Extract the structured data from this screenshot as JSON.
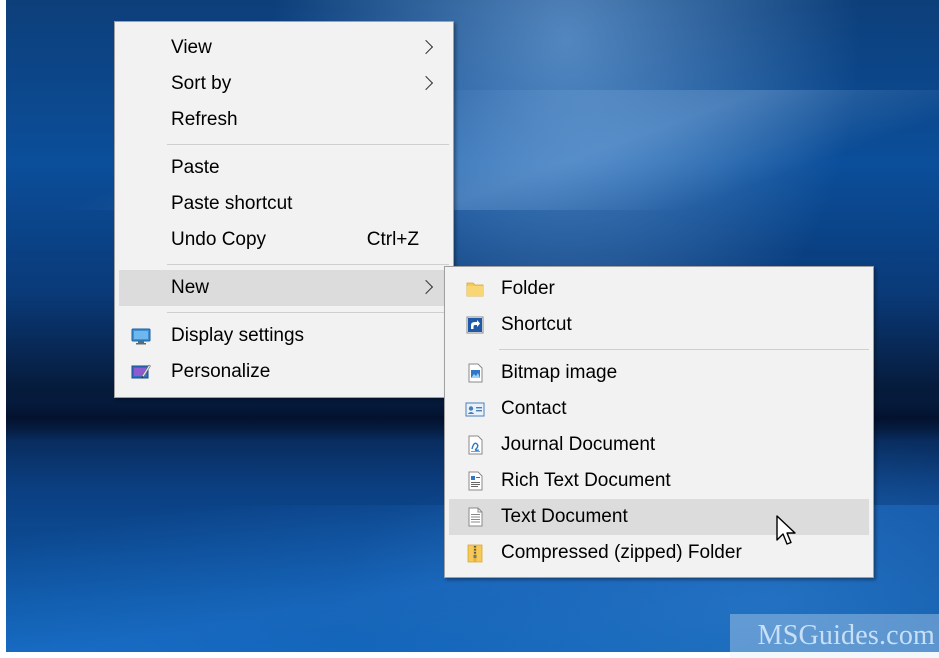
{
  "context_menu": {
    "items": [
      {
        "label": "View",
        "submenu": true
      },
      {
        "label": "Sort by",
        "submenu": true
      },
      {
        "label": "Refresh"
      },
      {
        "label": "Paste"
      },
      {
        "label": "Paste shortcut"
      },
      {
        "label": "Undo Copy",
        "shortcut": "Ctrl+Z"
      },
      {
        "label": "New",
        "submenu": true,
        "highlighted": true
      },
      {
        "label": "Display settings",
        "icon": "display-settings-icon"
      },
      {
        "label": "Personalize",
        "icon": "personalize-icon"
      }
    ]
  },
  "new_submenu": {
    "items": [
      {
        "label": "Folder",
        "icon": "folder-icon"
      },
      {
        "label": "Shortcut",
        "icon": "shortcut-icon"
      },
      {
        "label": "Bitmap image",
        "icon": "bitmap-image-icon"
      },
      {
        "label": "Contact",
        "icon": "contact-icon"
      },
      {
        "label": "Journal Document",
        "icon": "journal-document-icon"
      },
      {
        "label": "Rich Text Document",
        "icon": "rich-text-document-icon"
      },
      {
        "label": "Text Document",
        "icon": "text-document-icon",
        "highlighted": true
      },
      {
        "label": "Compressed (zipped) Folder",
        "icon": "zipped-folder-icon"
      }
    ]
  },
  "watermark": {
    "text": "MSGuides.com"
  },
  "colors": {
    "menu_bg": "#f2f2f2",
    "highlight": "#dcdcdc",
    "separator": "#cfcfcf",
    "folder": "#f5c95a",
    "shortcut_arrow": "#1e5aa8"
  }
}
